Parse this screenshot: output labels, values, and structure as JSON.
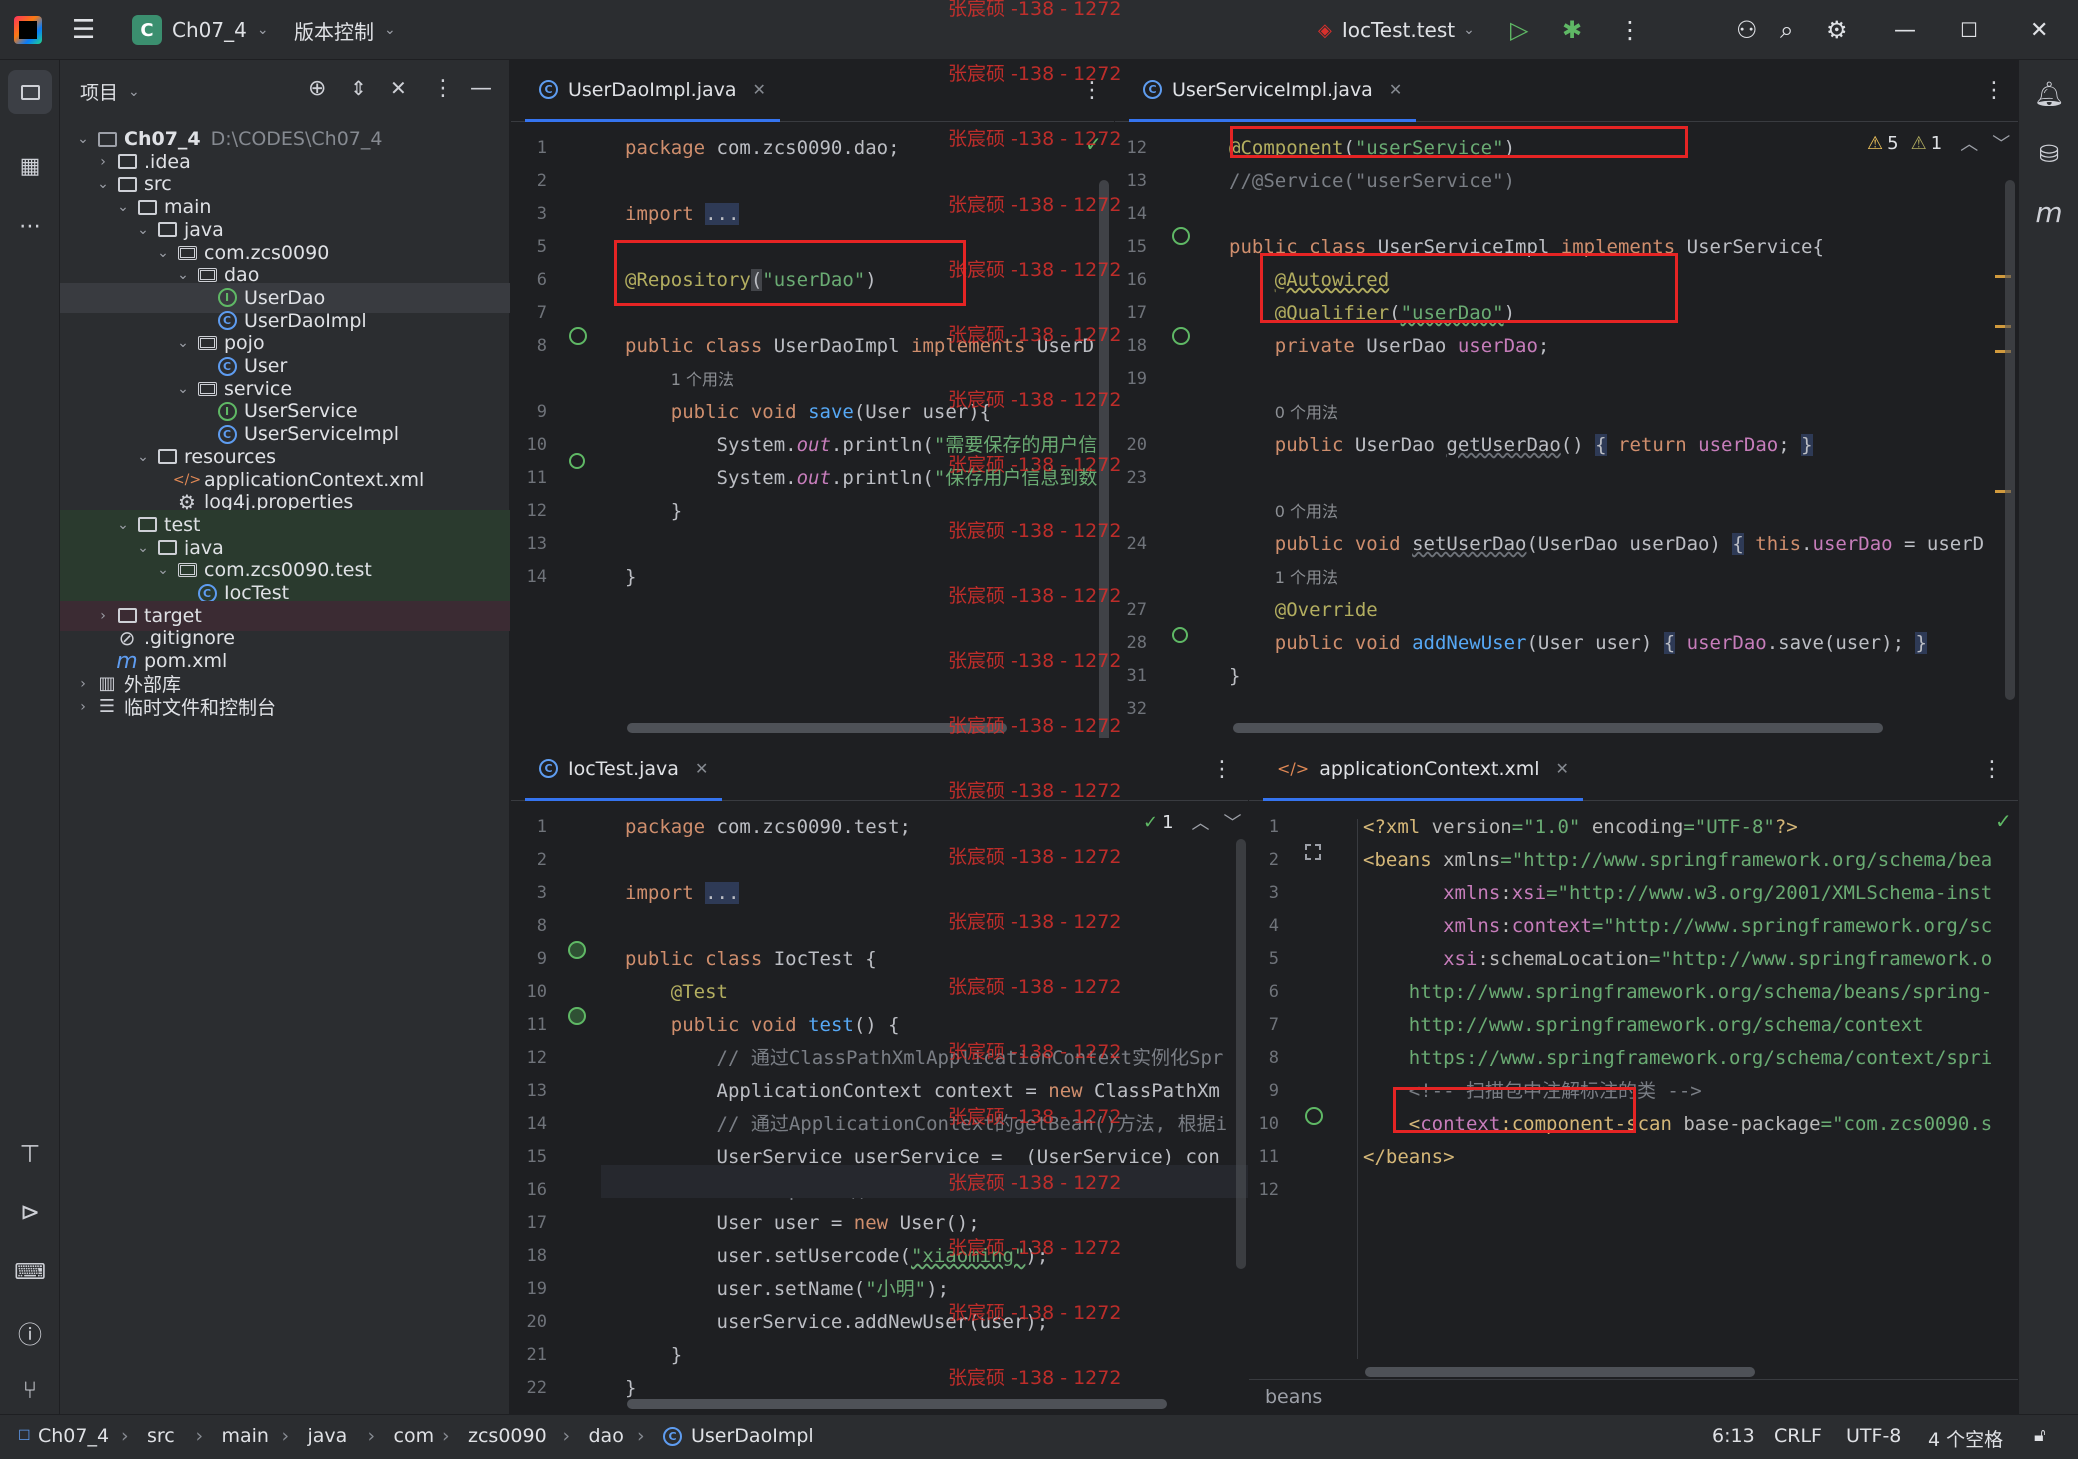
{
  "titlebar": {
    "project_badge": "C",
    "project": "Ch07_4",
    "vcs": "版本控制",
    "run_config": "IocTest.test"
  },
  "project_panel": {
    "title": "项目"
  },
  "tree": [
    {
      "label": "Ch07_4",
      "path": "D:\\CODES\\Ch07_4",
      "kind": "module",
      "depth": 0,
      "arrow": "open"
    },
    {
      "label": ".idea",
      "kind": "folder",
      "depth": 1,
      "arrow": "closed"
    },
    {
      "label": "src",
      "kind": "folder",
      "depth": 1,
      "arrow": "open"
    },
    {
      "label": "main",
      "kind": "folder",
      "depth": 2,
      "arrow": "open"
    },
    {
      "label": "java",
      "kind": "folder",
      "depth": 3,
      "arrow": "open"
    },
    {
      "label": "com.zcs0090",
      "kind": "package",
      "depth": 4,
      "arrow": "open"
    },
    {
      "label": "dao",
      "kind": "package",
      "depth": 5,
      "arrow": "open"
    },
    {
      "label": "UserDao",
      "kind": "interface",
      "depth": 6,
      "selected": true
    },
    {
      "label": "UserDaoImpl",
      "kind": "class",
      "depth": 6
    },
    {
      "label": "pojo",
      "kind": "package",
      "depth": 5,
      "arrow": "open"
    },
    {
      "label": "User",
      "kind": "class",
      "depth": 6
    },
    {
      "label": "service",
      "kind": "package",
      "depth": 5,
      "arrow": "open"
    },
    {
      "label": "UserService",
      "kind": "interface",
      "depth": 6
    },
    {
      "label": "UserServiceImpl",
      "kind": "class",
      "depth": 6
    },
    {
      "label": "resources",
      "kind": "folder",
      "depth": 3,
      "arrow": "open"
    },
    {
      "label": "applicationContext.xml",
      "kind": "xml",
      "depth": 4
    },
    {
      "label": "log4j.properties",
      "kind": "props",
      "depth": 4
    },
    {
      "label": "test",
      "kind": "folder",
      "depth": 2,
      "arrow": "open",
      "green": true
    },
    {
      "label": "java",
      "kind": "folder",
      "depth": 3,
      "arrow": "open",
      "green": true
    },
    {
      "label": "com.zcs0090.test",
      "kind": "package",
      "depth": 4,
      "arrow": "open",
      "green": true
    },
    {
      "label": "IocTest",
      "kind": "class",
      "depth": 5,
      "green": true
    },
    {
      "label": "target",
      "kind": "folder",
      "depth": 1,
      "arrow": "closed",
      "maroon": true
    },
    {
      "label": ".gitignore",
      "kind": "ignore",
      "depth": 1
    },
    {
      "label": "pom.xml",
      "kind": "maven",
      "depth": 1
    },
    {
      "label": "外部库",
      "kind": "lib",
      "depth": 0,
      "arrow": "closed"
    },
    {
      "label": "临时文件和控制台",
      "kind": "scratch",
      "depth": 0,
      "arrow": "closed"
    }
  ],
  "editors": {
    "tl": {
      "tab": "UserDaoImpl.java",
      "lines": [
        {
          "n": "1",
          "h": "<span class='kw'>package</span> <span class='plain'>com.zcs0090.dao;</span>"
        },
        {
          "n": "2",
          "h": ""
        },
        {
          "n": "3",
          "h": "<span class='kw'>import</span> <span class='plain' style='background:#2e3a56'>...</span>"
        },
        {
          "n": "5",
          "h": ""
        },
        {
          "n": "6",
          "h": "<span class='ann'>@Repository</span><span class='plain' style='background:#43454a'>(</span><span class='str'>\"userDao\"</span><span class='plain'>)</span>"
        },
        {
          "n": "7",
          "h": ""
        },
        {
          "n": "8",
          "h": "<span class='kw'>public class</span> <span class='plain'>UserDaoImpl</span> <span class='kw'>implements</span> <span class='plain'>UserD</span>"
        },
        {
          "n": "",
          "h": "    <span class='hint'>1 个用法</span>"
        },
        {
          "n": "9",
          "h": "    <span class='kw'>public void</span> <span class='fn'>save</span><span class='plain'>(User user){</span>"
        },
        {
          "n": "10",
          "h": "        <span class='plain'>System.</span><span class='it'>out</span><span class='plain'>.println(</span><span class='str'>\"需要保存的用户信</span>"
        },
        {
          "n": "11",
          "h": "        <span class='plain'>System.</span><span class='it'>out</span><span class='plain'>.println(</span><span class='str'>\"保存用户信息到数</span>"
        },
        {
          "n": "12",
          "h": "    <span class='plain'>}</span>"
        },
        {
          "n": "13",
          "h": ""
        },
        {
          "n": "14",
          "h": "<span class='plain'>}</span>"
        }
      ]
    },
    "tr": {
      "tab": "UserServiceImpl.java",
      "warn_count": "5",
      "weak_count": "1",
      "lines": [
        {
          "n": "12",
          "h": "<span class='ann'>@Component</span><span class='plain'>(</span><span class='str'>\"userService\"</span><span class='plain'>)</span>"
        },
        {
          "n": "13",
          "h": "<span class='cm'>//@Service(\"userService\")</span>"
        },
        {
          "n": "14",
          "h": ""
        },
        {
          "n": "15",
          "h": "<span class='kw'>public class</span> <span class='plain'>UserServiceImpl</span> <span class='kw'>implements</span> <span class='plain'>UserService{</span>"
        },
        {
          "n": "16",
          "h": "    <span class='ann' style='text-decoration:underline wavy #b3ae60'>@Autowired</span>"
        },
        {
          "n": "17",
          "h": "    <span class='ann'>@Qualifier</span><span class='plain'>(</span><span class='str' style='text-decoration:underline wavy #6aab73'>\"userDao\"</span><span class='plain'>)</span>"
        },
        {
          "n": "18",
          "h": "    <span class='kw'>private</span> <span class='plain'>UserDao</span> <span class='fld'>userDao</span><span class='plain'>;</span>"
        },
        {
          "n": "19",
          "h": ""
        },
        {
          "n": "",
          "h": "    <span class='hint'>0 个用法</span>"
        },
        {
          "n": "20",
          "h": "    <span class='kw'>public</span> <span class='plain'>UserDao</span> <span class='plain' style='text-decoration:underline wavy #6f737a'>getUserDao</span><span class='plain'>()</span> <span class='plain' style='background:#2e3a56'>{</span> <span class='kw'>return</span> <span class='fld'>userDao</span><span class='plain'>;</span> <span class='plain' style='background:#2e3a56'>}</span>"
        },
        {
          "n": "23",
          "h": ""
        },
        {
          "n": "",
          "h": "    <span class='hint'>0 个用法</span>"
        },
        {
          "n": "24",
          "h": "    <span class='kw'>public void</span> <span class='plain' style='text-decoration:underline wavy #6f737a'>setUserDao</span><span class='plain'>(UserDao userDao)</span> <span class='plain' style='background:#2e3a56'>{</span> <span class='kw'>this</span><span class='plain'>.</span><span class='fld'>userDao</span> <span class='plain'>= userD</span>"
        },
        {
          "n": "",
          "h": "    <span class='hint'>1 个用法</span>"
        },
        {
          "n": "27",
          "h": "    <span class='ann'>@Override</span>"
        },
        {
          "n": "28",
          "h": "    <span class='kw'>public void</span> <span class='fn'>addNewUser</span><span class='plain'>(User user)</span> <span class='plain' style='background:#2e3a56'>{</span> <span class='fld'>userDao</span><span class='plain'>.save(user);</span> <span class='plain' style='background:#2e3a56'>}</span>"
        },
        {
          "n": "31",
          "h": "<span class='plain'>}</span>"
        },
        {
          "n": "32",
          "h": ""
        }
      ]
    },
    "bl": {
      "tab": "IocTest.java",
      "check_count": "1",
      "lines": [
        {
          "n": "1",
          "h": "<span class='kw'>package</span> <span class='plain'>com.zcs0090.test;</span>"
        },
        {
          "n": "2",
          "h": ""
        },
        {
          "n": "3",
          "h": "<span class='kw'>import</span> <span class='plain' style='background:#2e3a56'>...</span>"
        },
        {
          "n": "8",
          "h": ""
        },
        {
          "n": "9",
          "h": "<span class='kw'>public class</span> <span class='plain'>IocTest {</span>"
        },
        {
          "n": "10",
          "h": "    <span class='ann'>@Test</span>"
        },
        {
          "n": "11",
          "h": "    <span class='kw'>public void</span> <span class='fn'>test</span><span class='plain'>() {</span>"
        },
        {
          "n": "12",
          "h": "        <span class='cm'>// 通过ClassPathXmlApplicationContext实例化Spr</span>"
        },
        {
          "n": "13",
          "h": "        <span class='plain'>ApplicationContext context = </span><span class='kw'>new</span> <span class='plain'>ClassPathXm</span>"
        },
        {
          "n": "14",
          "h": "        <span class='cm'>// 通过ApplicationContext的getBean()方法, 根据i</span>"
        },
        {
          "n": "15",
          "h": "        <span class='plain'>UserService userService =  (UserService) con</span>"
        },
        {
          "n": "16",
          "h": "        <span class='cm'>// 执行print()方法</span>"
        },
        {
          "n": "17",
          "h": "        <span class='plain'>User user = </span><span class='kw'>new</span> <span class='plain'>User();</span>"
        },
        {
          "n": "18",
          "h": "        <span class='plain'>user.setUsercode(</span><span class='str' style='text-decoration:underline wavy #6aab73'>\"xiaoming\"</span><span class='plain'>);</span>"
        },
        {
          "n": "19",
          "h": "        <span class='plain'>user.setName(</span><span class='str'>\"小明\"</span><span class='plain'>);</span>"
        },
        {
          "n": "20",
          "h": "        <span class='plain'>userService.addNewUser(user);</span>"
        },
        {
          "n": "21",
          "h": "    <span class='plain'>}</span>"
        },
        {
          "n": "22",
          "h": "<span class='plain'>}</span>"
        }
      ]
    },
    "br": {
      "tab": "applicationContext.xml",
      "breadcrumb": "beans",
      "lines": [
        {
          "n": "1",
          "h": "<span class='tag'>&lt;?xml</span> <span class='attr'>version</span><span class='str'>=\"1.0\"</span> <span class='attr'>encoding</span><span class='str'>=\"UTF-8\"</span><span class='tag'>?&gt;</span>"
        },
        {
          "n": "2",
          "h": "<span class='tag'>&lt;beans</span> <span class='attr'>xmlns</span><span class='str'>=\"http://www.springframework.org/schema/bea</span>"
        },
        {
          "n": "3",
          "h": "       <span class='ns'>xmlns</span><span class='attr'>:</span><span class='ns'>xsi</span><span class='str'>=\"http://www.w3.org/2001/XMLSchema-inst</span>"
        },
        {
          "n": "4",
          "h": "       <span class='ns'>xmlns</span><span class='attr'>:</span><span class='ns'>context</span><span class='str'>=\"http://www.springframework.org/sc</span>"
        },
        {
          "n": "5",
          "h": "       <span class='ns'>xsi</span><span class='attr'>:schemaLocation</span><span class='str'>=\"http://www.springframework.o</span>"
        },
        {
          "n": "6",
          "h": "    <span class='str'>http://www.springframework.org/schema/beans/spring-</span>"
        },
        {
          "n": "7",
          "h": "    <span class='str'>http://www.springframework.org/schema/context</span>"
        },
        {
          "n": "8",
          "h": "    <span class='str'>https://www.springframework.org/schema/context/spri</span>"
        },
        {
          "n": "9",
          "h": "    <span class='cm'>&lt;!-- 扫描包中注解标注的类 --&gt;</span>"
        },
        {
          "n": "10",
          "h": "    <span class='tag'>&lt;</span><span class='ns'>context</span><span class='tag'>:component-scan</span> <span class='attr'>base-package</span><span class='str'>=\"com.zcs0090.s</span>"
        },
        {
          "n": "11",
          "h": "<span class='tag'>&lt;/beans&gt;</span>"
        },
        {
          "n": "12",
          "h": ""
        }
      ]
    }
  },
  "watermark": "张宸硕 -138 - 1272",
  "statusbar": {
    "crumbs": [
      "Ch07_4",
      "src",
      "main",
      "java",
      "com",
      "zcs0090",
      "dao",
      "UserDaoImpl"
    ],
    "position": "6:13",
    "line_sep": "CRLF",
    "encoding": "UTF-8",
    "indent": "4 个空格"
  }
}
